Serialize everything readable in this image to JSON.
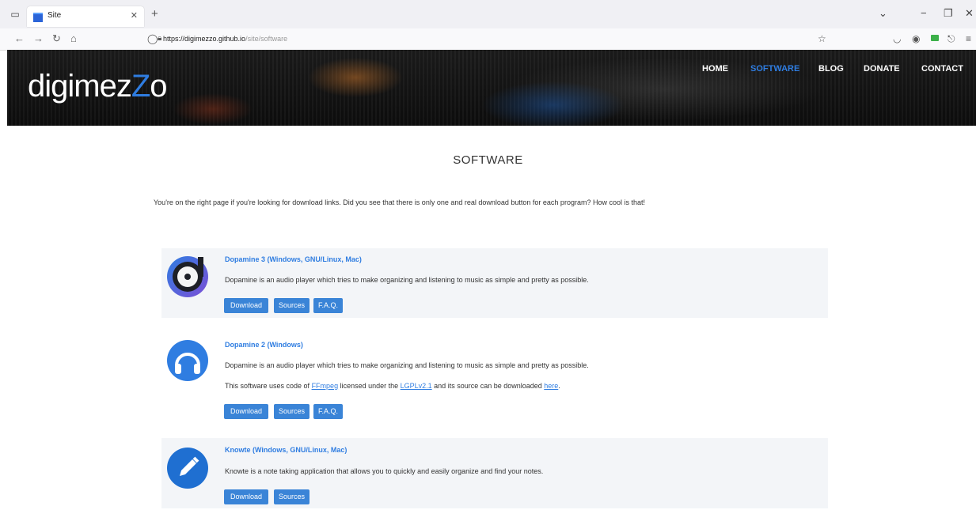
{
  "browser": {
    "tab_title": "Site",
    "url_domain": "https://digimezzo.github.io",
    "url_path": "/site/software"
  },
  "site": {
    "logo_pre": "digime",
    "logo_z1": "z",
    "logo_z2": "Z",
    "logo_post": "o",
    "menu": {
      "home": "HOME",
      "software": "SOFTWARE",
      "blog": "BLOG",
      "donate": "DONATE",
      "contact": "CONTACT"
    }
  },
  "page": {
    "title": "SOFTWARE",
    "intro": "You're on the right page if you're looking for download links. Did you see that there is only one and real download button for each program? How cool is that!"
  },
  "apps": [
    {
      "title": "Dopamine 3 (Windows, GNU/Linux, Mac)",
      "desc": "Dopamine is an audio player which tries to make organizing and listening to music as simple and pretty as possible.",
      "buttons": [
        "Download",
        "Sources",
        "F.A.Q."
      ]
    },
    {
      "title": "Dopamine 2 (Windows)",
      "desc": "Dopamine is an audio player which tries to make organizing and listening to music as simple and pretty as possible.",
      "license_pre": "This software uses code of ",
      "license_link1": "FFmpeg",
      "license_mid": " licensed under the ",
      "license_link2": "LGPLv2.1",
      "license_mid2": " and its source can be downloaded ",
      "license_link3": "here",
      "license_end": ".",
      "buttons": [
        "Download",
        "Sources",
        "F.A.Q."
      ]
    },
    {
      "title": "Knowte (Windows, GNU/Linux, Mac)",
      "desc": "Knowte is a note taking application that allows you to quickly and easily organize and find your notes.",
      "buttons": [
        "Download",
        "Sources"
      ]
    }
  ],
  "colors": {
    "accent": "#2f7de1",
    "button": "#3a84d7",
    "card_bg": "#f3f5f8"
  }
}
